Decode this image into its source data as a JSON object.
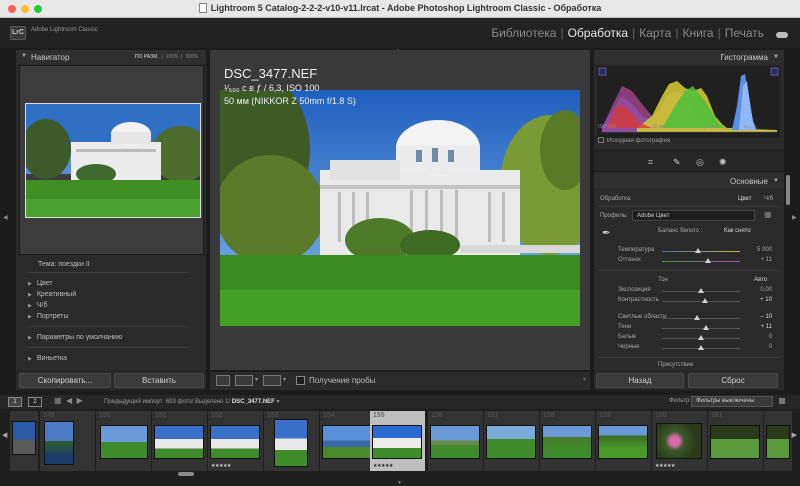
{
  "window": {
    "title": "Lightroom 5 Catalog-2-2-2-v10-v11.lrcat - Adobe Photoshop Lightroom Classic - Обработка"
  },
  "identity": {
    "badge": "LrC",
    "app_name": "Adobe Lightroom Classic"
  },
  "modules": [
    {
      "label": "Библиотека",
      "active": false
    },
    {
      "label": "Обработка",
      "active": true
    },
    {
      "label": "Карта",
      "active": false
    },
    {
      "label": "Книга",
      "active": false
    },
    {
      "label": "Печать",
      "active": false
    }
  ],
  "navigator": {
    "title": "Навигатор",
    "zoom_fit": "ПО РАЗМ.",
    "zoom_100": "100%",
    "zoom_300": "300%"
  },
  "presets": {
    "items": [
      "Тема: поездки II",
      "Цвет",
      "Креативный",
      "Ч/б",
      "Портреты",
      "Параметры по умолчанию",
      "Виньетка"
    ]
  },
  "left_buttons": {
    "copy": "Скопировать...",
    "paste": "Вставить"
  },
  "photo_info": {
    "filename": "DSC_3477.NEF",
    "exposure": "¹⁄₅₀₀ с в ƒ / 6,3, ISO 100",
    "lens": "50 мм (NIKKOR Z 50mm f/1.8 S)"
  },
  "toolbar": {
    "proof_label": "Получение пробы"
  },
  "histogram": {
    "title": "Гистограмма",
    "iso": "ISO 100",
    "focal": "50 мм",
    "aperture": "ƒ / 6,3",
    "shutter": "¹⁄₅₀₀ с",
    "original_photo": "Исходная фотография"
  },
  "basic": {
    "title": "Основные",
    "treatment_label": "Обработка:",
    "treatment_color": "Цвет",
    "treatment_bw": "Ч/б",
    "profile_label": "Профиль:",
    "profile_value": "Adobe Цвет",
    "wb_label": "Баланс белого :",
    "wb_value": "Как снято",
    "temperature_label": "Температура",
    "temperature_value": "5 000",
    "tint_label": "Оттенок",
    "tint_value": "+ 11",
    "tone_label": "Тон",
    "auto_label": "Авто",
    "sliders": [
      {
        "label": "Экспозиция",
        "value": "0,00"
      },
      {
        "label": "Контрастность",
        "value": "+ 10"
      },
      {
        "label": "Светлые области",
        "value": "– 10"
      },
      {
        "label": "Тени",
        "value": "+ 11"
      },
      {
        "label": "Белые",
        "value": "0"
      },
      {
        "label": "Черные",
        "value": "0"
      }
    ],
    "presence_label": "Присутствие"
  },
  "right_buttons": {
    "back": "Назад",
    "reset": "Сброс"
  },
  "filmstrip_bar": {
    "page1": "1",
    "page2": "2",
    "source_prefix": "Предыдущий импорт",
    "source_count": "693 фото/ Выделено 1/",
    "source_file": "DSC_3477.NEF",
    "filter_label": "Фильтр:",
    "filter_value": "Фильтры выключены"
  },
  "filmstrip": [
    {
      "num": "",
      "stars": ""
    },
    {
      "num": "149",
      "stars": ""
    },
    {
      "num": "150",
      "stars": ""
    },
    {
      "num": "151",
      "stars": ""
    },
    {
      "num": "152",
      "stars": "★★★★★"
    },
    {
      "num": "153",
      "stars": ""
    },
    {
      "num": "154",
      "stars": ""
    },
    {
      "num": "155",
      "stars": "★★★★★"
    },
    {
      "num": "156",
      "stars": ""
    },
    {
      "num": "157",
      "stars": ""
    },
    {
      "num": "158",
      "stars": ""
    },
    {
      "num": "159",
      "stars": ""
    },
    {
      "num": "160",
      "stars": "★★★★★"
    },
    {
      "num": "161",
      "stars": ""
    },
    {
      "num": "",
      "stars": ""
    }
  ],
  "colors": {
    "accent_red": "#fe5f57",
    "accent_yellow": "#febc2e",
    "accent_green": "#28c840",
    "panel_bg": "#2a2a2a",
    "selected_cell": "#bfbfbf"
  }
}
